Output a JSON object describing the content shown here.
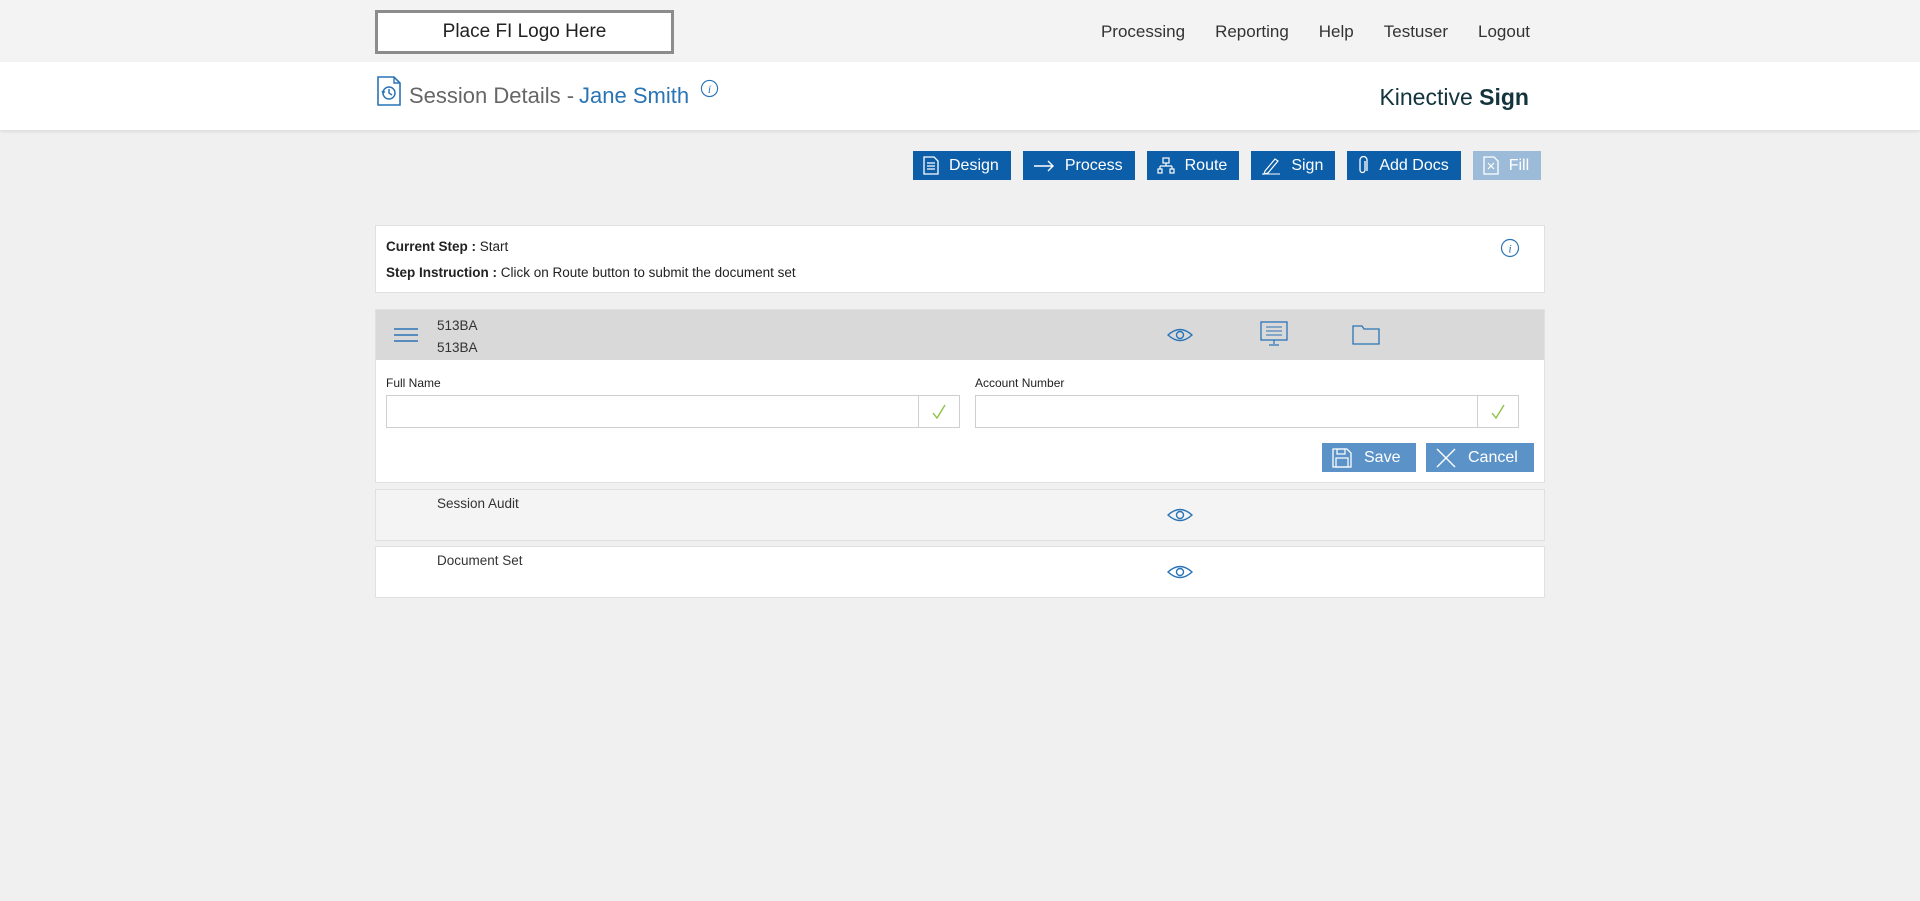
{
  "topbar": {
    "logo_text": "Place FI Logo Here",
    "nav": [
      "Processing",
      "Reporting",
      "Help",
      "Testuser",
      "Logout"
    ]
  },
  "header": {
    "title": "Session Details -",
    "name": "Jane Smith",
    "brand_regular": "Kinective ",
    "brand_bold": "Sign"
  },
  "toolbar": {
    "design": "Design",
    "process": "Process",
    "route": "Route",
    "sign": "Sign",
    "add_docs": "Add Docs",
    "fill": "Fill"
  },
  "step": {
    "current_label": "Current Step :",
    "current_value": " Start",
    "instruction_label": "Step Instruction :",
    "instruction_value": " Click on Route button to submit the document set"
  },
  "document": {
    "line1": "513BA",
    "line2": "513BA",
    "fields": {
      "full_name_label": "Full Name",
      "full_name_value": "",
      "account_number_label": "Account Number",
      "account_number_value": ""
    },
    "save": "Save",
    "cancel": "Cancel"
  },
  "rows": {
    "session_audit": "Session Audit",
    "document_set": "Document Set"
  },
  "colors": {
    "primary": "#0d5ea8",
    "disabled": "#9bbbd9",
    "secondary": "#5b93c8",
    "link": "#2a74b6"
  }
}
